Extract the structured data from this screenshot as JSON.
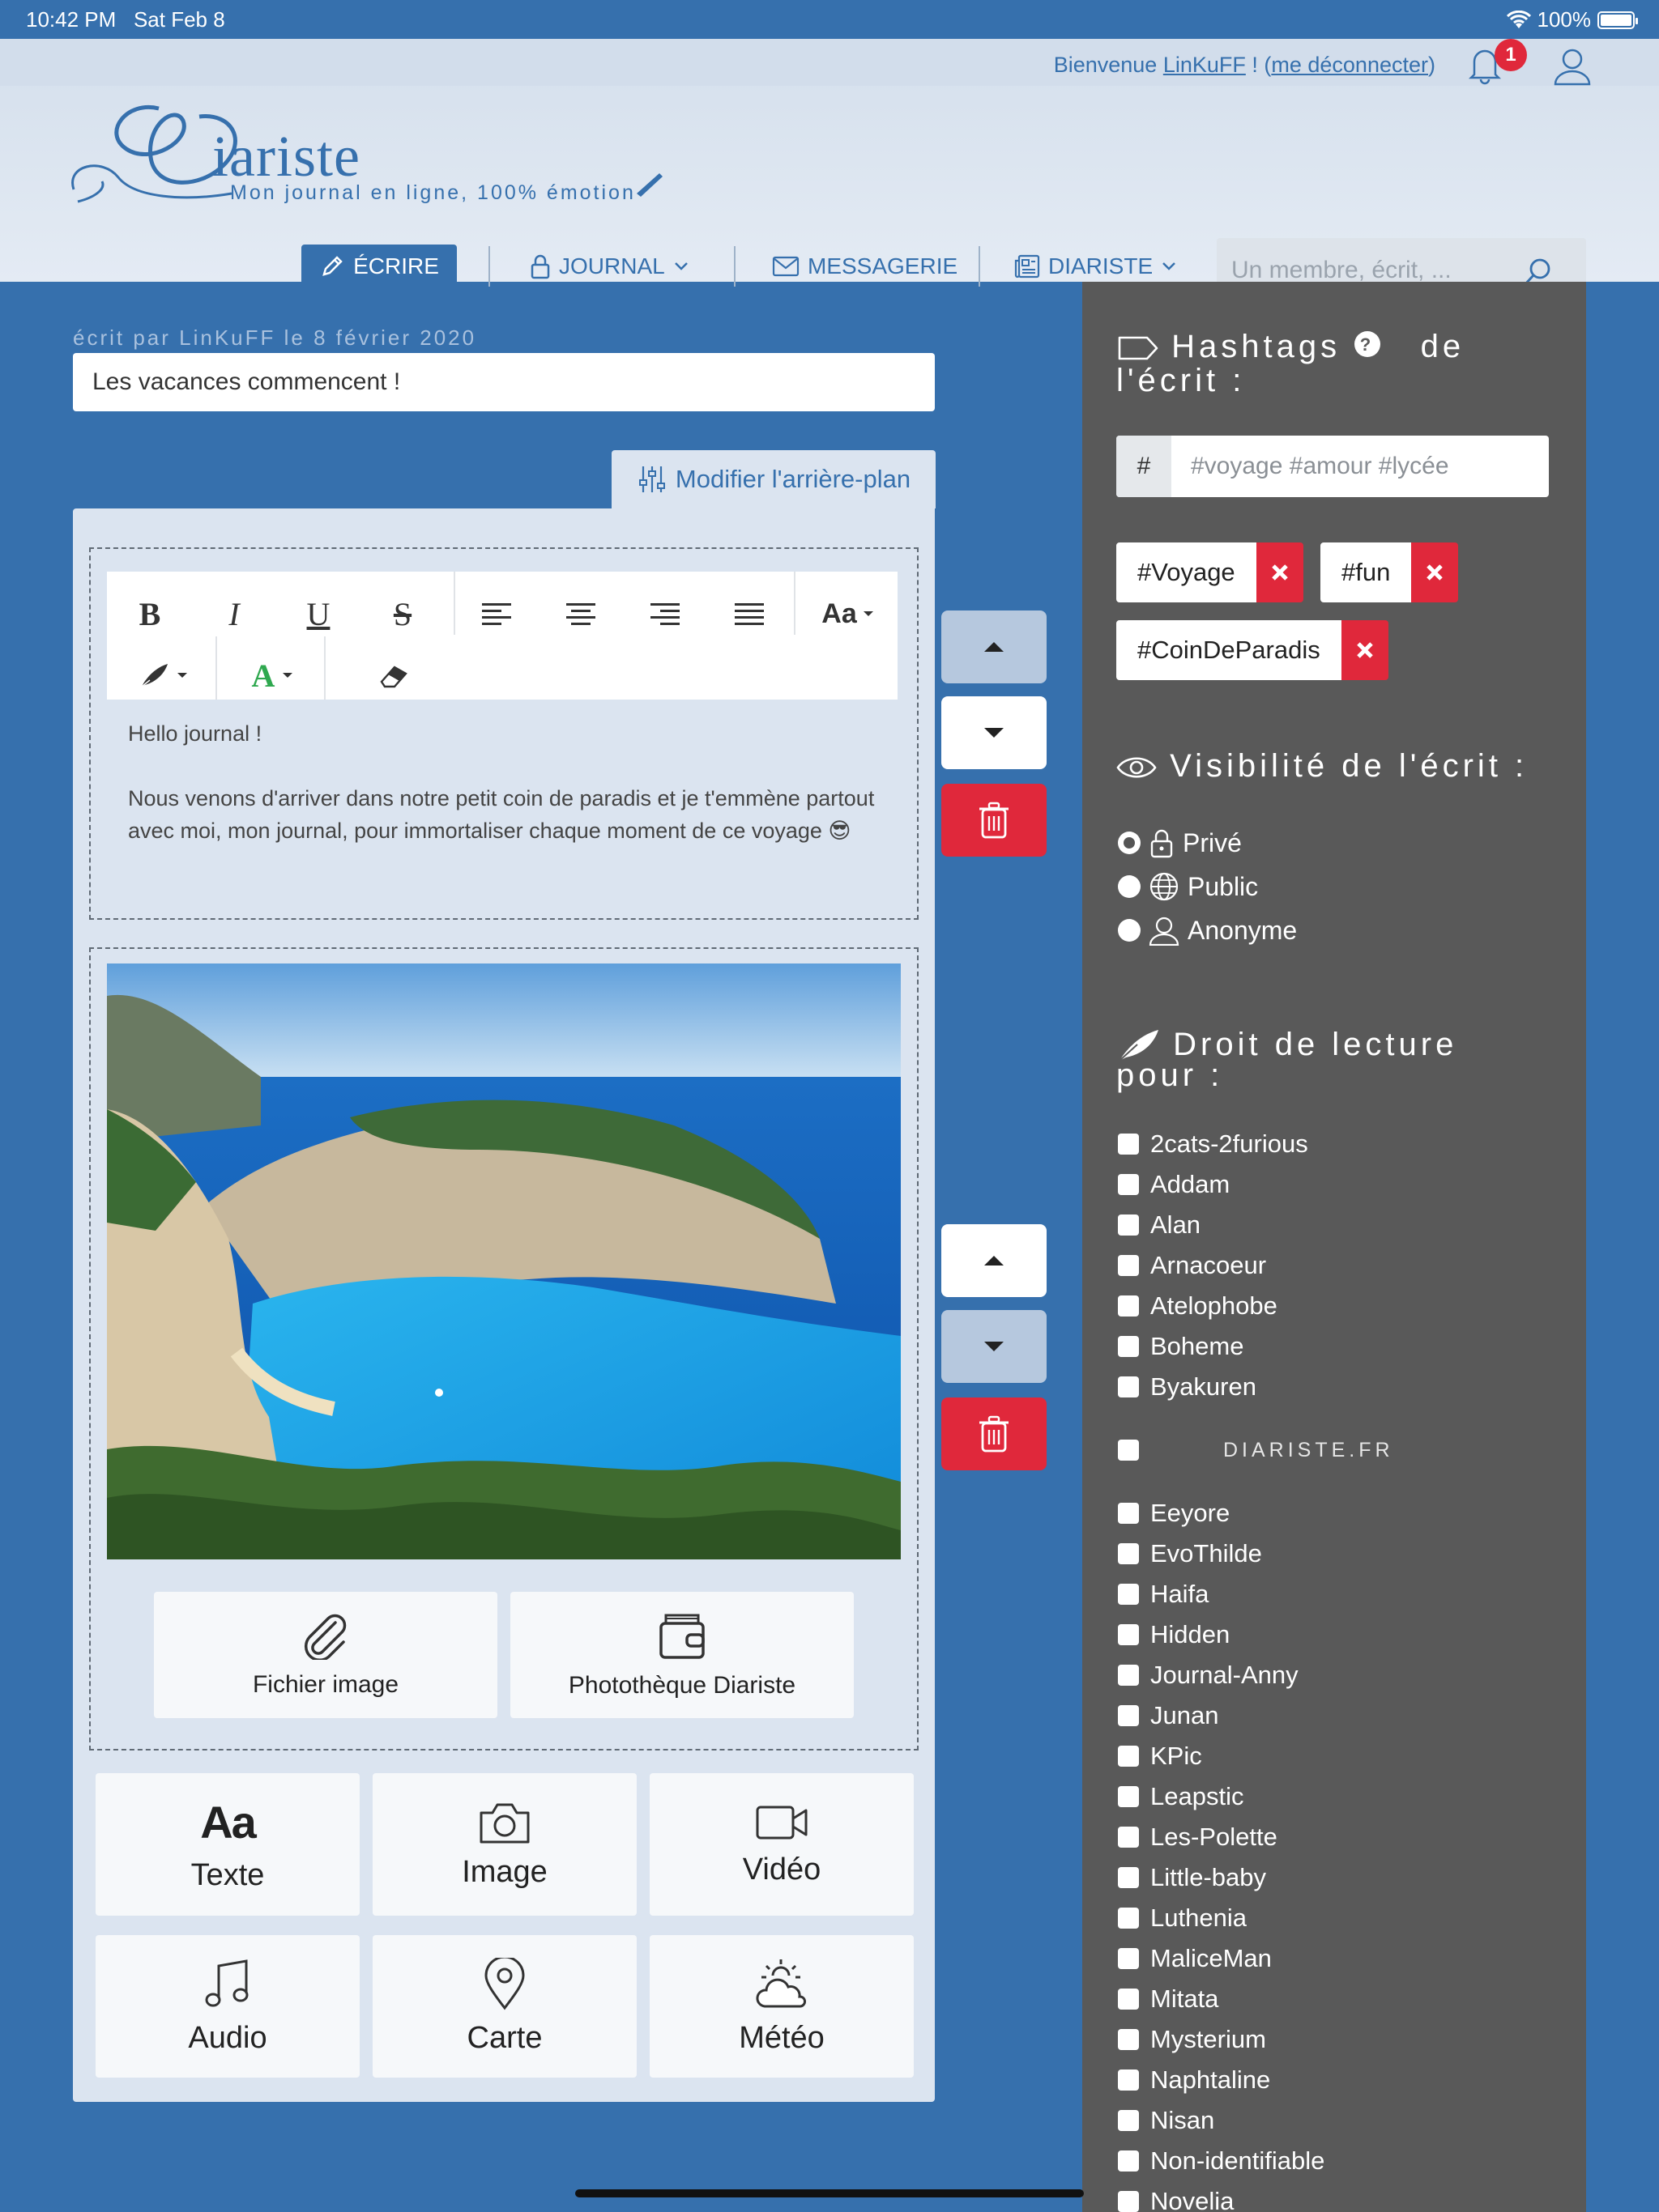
{
  "status": {
    "time": "10:42 PM",
    "date": "Sat Feb 8",
    "battery": "100%"
  },
  "header": {
    "welcome_prefix": "Bienvenue",
    "username": "LinKuFF",
    "welcome_mid": "! (",
    "logout": "me déconnecter",
    "welcome_end": ")",
    "notifications": "1",
    "logo_title": "iariste",
    "logo_sub": "Mon journal en ligne, 100% émotion"
  },
  "nav": {
    "write": "ÉCRIRE",
    "journal": "JOURNAL",
    "messaging": "MESSAGERIE",
    "diariste": "DIARISTE",
    "search_placeholder": "Un membre, écrit, ..."
  },
  "entry": {
    "byline": "écrit par LinKuFF le 8 février 2020",
    "title": "Les vacances commencent !",
    "bg_button": "Modifier l'arrière-plan",
    "text_line1": "Hello journal !",
    "text_line2": "Nous venons d'arriver dans notre petit coin de paradis et je t'emmène partout avec moi, mon journal, pour immortaliser chaque moment de ce voyage 😎",
    "upload_file": "Fichier image",
    "upload_library": "Photothèque Diariste"
  },
  "add_blocks": [
    "Texte",
    "Image",
    "Vidéo",
    "Audio",
    "Carte",
    "Météo"
  ],
  "sidebar": {
    "hashtags_title_a": "Hashtags",
    "hashtags_title_b": "de",
    "hashtags_title_c": "l'écrit :",
    "hash_prefix": "#",
    "hash_placeholder": "#voyage #amour #lycée",
    "tags": [
      "#Voyage",
      "#fun",
      "#CoinDeParadis"
    ],
    "visibility_title": "Visibilité de l'écrit :",
    "visibility_options": [
      "Privé",
      "Public",
      "Anonyme"
    ],
    "visibility_selected": "Privé",
    "readers_title_a": "Droit de lecture",
    "readers_title_b": "pour :",
    "readers_before": [
      "2cats-2furious",
      "Addam",
      "Alan",
      "Arnacoeur",
      "Atelophobe",
      "Boheme",
      "Byakuren"
    ],
    "readers_watermark": "DIARISTE.FR",
    "readers_after": [
      "Eeyore",
      "EvoThilde",
      "Haifa",
      "Hidden",
      "Journal-Anny",
      "Junan",
      "KPic",
      "Leapstic",
      "Les-Polette",
      "Little-baby",
      "Luthenia",
      "MaliceMan",
      "Mitata",
      "Mysterium",
      "Naphtaline",
      "Nisan",
      "Non-identifiable",
      "Novelia"
    ]
  },
  "colors": {
    "brand_blue": "#3670ad",
    "danger_red": "#e0283b",
    "sidebar_gray": "#595959",
    "panel": "#dbe4f0"
  }
}
